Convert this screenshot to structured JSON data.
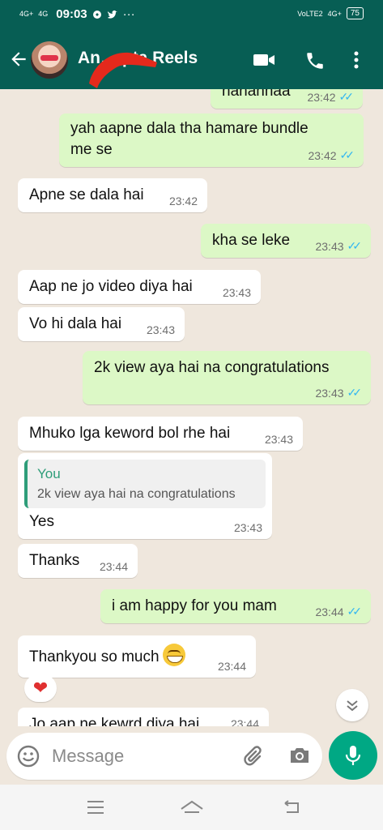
{
  "status_bar": {
    "signal_left_1": "4G+",
    "signal_left_2": "4G",
    "time": "09:03",
    "dots": "···",
    "volte": "VoLTE2",
    "network_right": "4G+",
    "battery": "75"
  },
  "header": {
    "contact_name": "An… pta Reels",
    "back_icon": "arrow-left-icon",
    "video_icon": "video-camera-icon",
    "call_icon": "phone-icon",
    "more_icon": "more-vertical-icon"
  },
  "messages": [
    {
      "dir": "out",
      "text": "hahahhaa",
      "time": "23:42",
      "read": true
    },
    {
      "dir": "out",
      "line1": "yah aapne dala tha  hamare bundle",
      "line2": "me se",
      "time": "23:42",
      "read": true
    },
    {
      "dir": "in",
      "text": "Apne se dala hai",
      "time": "23:42"
    },
    {
      "dir": "out",
      "text": "kha se leke",
      "time": "23:43",
      "read": true
    },
    {
      "dir": "in",
      "text": "Aap ne jo video diya hai",
      "time": "23:43"
    },
    {
      "dir": "in",
      "text": "Vo hi dala hai",
      "time": "23:43"
    },
    {
      "dir": "out",
      "text": "2k view aya hai na congratulations",
      "time": "23:43",
      "read": true
    },
    {
      "dir": "in",
      "text": "Mhuko lga keword bol rhe hai",
      "time": "23:43"
    },
    {
      "dir": "in",
      "quote_name": "You",
      "quote_text": "2k view aya hai na congratulations",
      "text": "Yes",
      "time": "23:43"
    },
    {
      "dir": "in",
      "text": "Thanks",
      "time": "23:44"
    },
    {
      "dir": "out",
      "text": "i am happy for you mam",
      "time": "23:44",
      "read": true
    },
    {
      "dir": "in",
      "text": "Thankyou so much",
      "time": "23:44",
      "reaction": "❤"
    },
    {
      "dir": "in",
      "text": "Jo aap ne kewrd diya hai",
      "time": "23:44"
    }
  ],
  "composer": {
    "placeholder": "Message",
    "emoji_icon": "emoji-icon",
    "attach_icon": "paperclip-icon",
    "camera_icon": "camera-icon",
    "mic_icon": "microphone-icon"
  },
  "colors": {
    "header": "#075e54",
    "outgoing_bubble": "#dcf8c6",
    "incoming_bubble": "#ffffff",
    "accent": "#00a884",
    "read_ticks": "#34b7f1"
  }
}
